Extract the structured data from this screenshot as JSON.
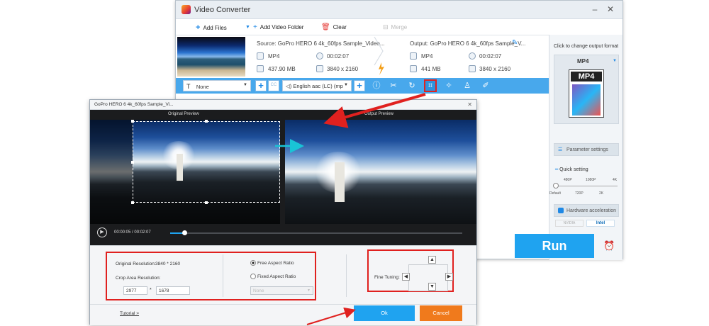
{
  "main_window": {
    "title": "Video Converter",
    "toolbar": {
      "add_files": "Add Files",
      "add_video_folder": "Add Video Folder",
      "clear": "Clear",
      "merge": "Merge"
    },
    "file": {
      "source": "Source: GoPro HERO 6 4k_60fps Sample_Video...",
      "output": "Output: GoPro HERO 6 4k_60fps Sample_V...",
      "src_format": "MP4",
      "src_duration": "00:02:07",
      "src_size": "437.90 MB",
      "src_resolution": "3840 x 2160",
      "out_format": "MP4",
      "out_duration": "00:02:07",
      "out_size": "441 MB",
      "out_resolution": "3840 x 2160"
    },
    "edit_bar": {
      "subtitle": "None",
      "audio": "English aac (LC) (mp"
    },
    "side_panel": {
      "change_format": "Click to change output format",
      "format": "MP4",
      "format_icon_text": "MP4",
      "parameter_settings": "Parameter settings",
      "quick_setting": "Quick setting",
      "ticks_top": [
        "480P",
        "1080P",
        "4K"
      ],
      "ticks_bottom": [
        "Default",
        "720P",
        "2K"
      ],
      "hardware_acceleration": "Hardware acceleration",
      "gpu_nvidia": "NVIDIA",
      "gpu_intel": "Intel"
    },
    "run": "Run"
  },
  "crop_dialog": {
    "title": "GoPro HERO 6 4k_60fps Sample_Vi...",
    "original_preview": "Original Preview",
    "output_preview": "Output Preview",
    "time_current": "00:00:05",
    "time_sep": "/",
    "time_total": "00:02:07",
    "original_resolution_label": "Original Resolution:",
    "original_resolution_value": "3840 * 2160",
    "crop_area_label": "Crop Area Resolution:",
    "crop_width": "2977",
    "crop_height": "1678",
    "multiply": "*",
    "free_aspect": "Free Aspect Ratio",
    "fixed_aspect": "Fixed Aspect Ratio",
    "aspect_select": "None",
    "fine_tuning": "Fine Tuning:",
    "tutorial": "Tutorial >",
    "ok": "Ok",
    "cancel": "Cancel"
  }
}
